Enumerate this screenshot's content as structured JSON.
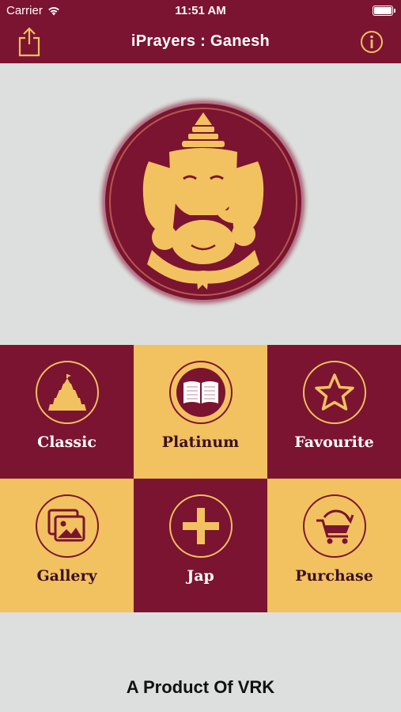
{
  "status_bar": {
    "carrier": "Carrier",
    "time": "11:51 AM",
    "battery_level": 1.0
  },
  "nav_bar": {
    "title": "iPrayers : Ganesh",
    "left_icon": "share-icon",
    "right_icon": "info-icon"
  },
  "colors": {
    "maroon": "#7b1430",
    "gold": "#f2c160",
    "background": "#dcdfdd"
  },
  "menu": [
    {
      "label": "Classic",
      "icon": "temple-icon"
    },
    {
      "label": "Platinum",
      "icon": "book-icon"
    },
    {
      "label": "Favourite",
      "icon": "star-icon"
    },
    {
      "label": "Gallery",
      "icon": "gallery-icon"
    },
    {
      "label": "Jap",
      "icon": "plus-icon"
    },
    {
      "label": "Purchase",
      "icon": "cart-icon"
    }
  ],
  "footer": {
    "text": "A Product Of VRK"
  }
}
